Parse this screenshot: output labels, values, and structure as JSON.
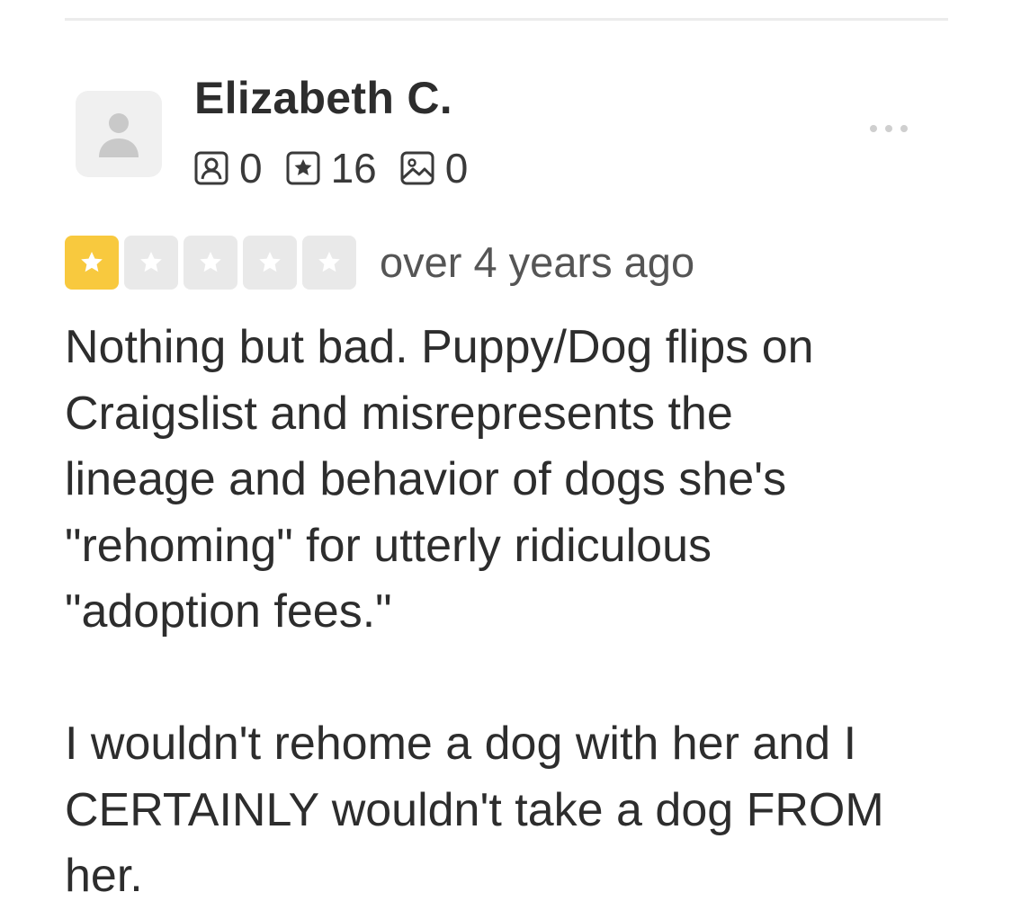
{
  "review": {
    "user": {
      "name": "Elizabeth C.",
      "stats": {
        "friends": "0",
        "reviews": "16",
        "photos": "0"
      }
    },
    "rating": {
      "value": 1,
      "max": 5,
      "filled_color": "#f8c93e",
      "empty_color": "#e9e9e9"
    },
    "date": "over 4 years ago",
    "paragraphs": [
      "Nothing but bad.  Puppy/Dog flips on\nCraigslist and misrepresents the\nlineage and behavior of dogs she's\n\"rehoming\" for utterly ridiculous\n\"adoption fees.\"",
      "I wouldn't rehome a dog with her and I\nCERTAINLY wouldn't take a dog FROM\nher."
    ]
  },
  "icons": {
    "avatar": "user-placeholder-icon",
    "friends": "friends-icon",
    "reviews": "review-star-icon",
    "photos": "photo-icon",
    "menu": "more-options-icon"
  }
}
